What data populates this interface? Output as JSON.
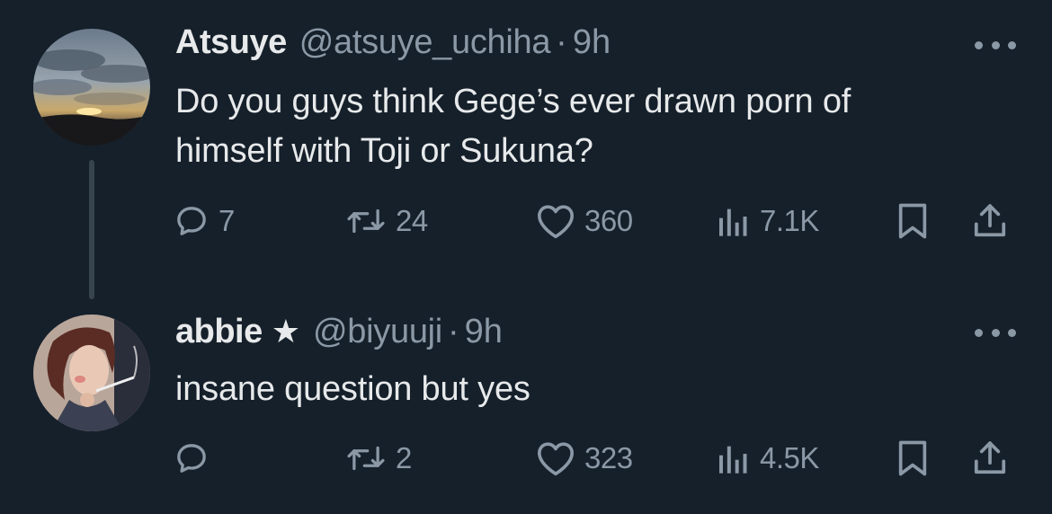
{
  "tweets": [
    {
      "name": "Atsuye",
      "handle": "@atsuye_uchiha",
      "separator": "·",
      "time": "9h",
      "text_lines": [
        "Do you guys think Gege’s ever drawn porn of",
        "himself with Toji or Sukuna?"
      ],
      "replies": "7",
      "retweets": "24",
      "likes": "360",
      "views": "7.1K",
      "avatar": "sunset-sky-avatar"
    },
    {
      "name": "abbie",
      "badge": "★",
      "handle": "@biyuuji",
      "separator": "·",
      "time": "9h",
      "text_lines": [
        "insane question but yes"
      ],
      "replies": "",
      "retweets": "2",
      "likes": "323",
      "views": "4.5K",
      "avatar": "anime-character-smoking-avatar"
    }
  ],
  "icons": {
    "reply": "reply-icon",
    "retweet": "retweet-icon",
    "like": "heart-icon",
    "views": "views-icon",
    "bookmark": "bookmark-icon",
    "share": "share-icon",
    "more": "more-icon"
  },
  "colors": {
    "background": "#15202b",
    "text": "#e7e9ea",
    "muted": "#8b98a5",
    "thread_line": "#38444d"
  }
}
